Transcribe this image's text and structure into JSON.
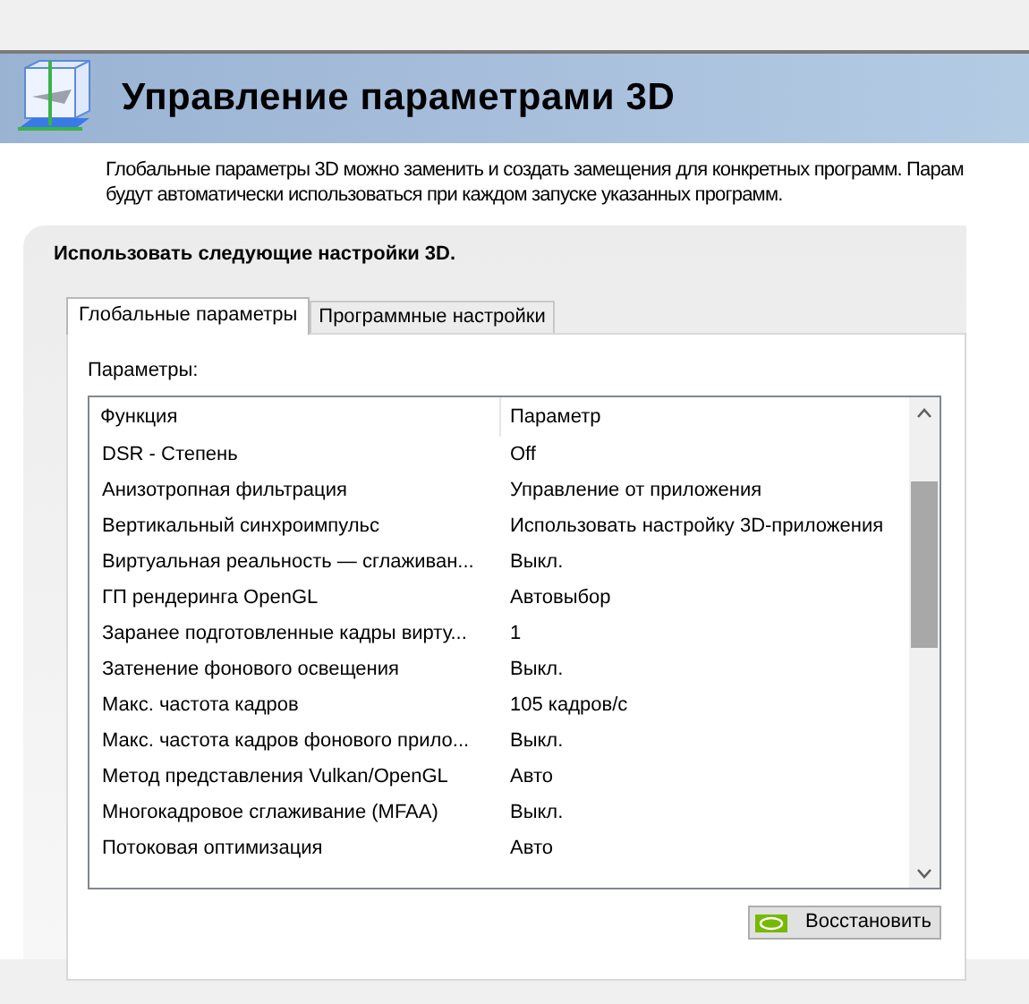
{
  "header": {
    "title": "Управление параметрами 3D"
  },
  "description": [
    "Глобальные параметры 3D можно заменить и создать замещения для конкретных программ. Парам",
    "будут автоматически использоваться при каждом запуске указанных программ."
  ],
  "panel": {
    "heading": "Использовать следующие настройки 3D."
  },
  "tabs": [
    {
      "label": "Глобальные параметры",
      "selected": true
    },
    {
      "label": "Программные настройки",
      "selected": false
    }
  ],
  "settings": {
    "label": "Параметры:",
    "columns": [
      "Функция",
      "Параметр"
    ],
    "rows": [
      {
        "function": "DSR - Степень",
        "value": "Off"
      },
      {
        "function": "Анизотропная фильтрация",
        "value": "Управление от приложения"
      },
      {
        "function": "Вертикальный синхроимпульс",
        "value": "Использовать настройку 3D-приложения"
      },
      {
        "function": "Виртуальная реальность — сглаживан...",
        "value": "Выкл."
      },
      {
        "function": "ГП рендеринга OpenGL",
        "value": "Автовыбор"
      },
      {
        "function": "Заранее подготовленные кадры вирту...",
        "value": "1"
      },
      {
        "function": "Затенение фонового освещения",
        "value": "Выкл."
      },
      {
        "function": "Макс. частота кадров",
        "value": "105 кадров/с"
      },
      {
        "function": "Макс. частота кадров фонового прило...",
        "value": "Выкл."
      },
      {
        "function": "Метод представления Vulkan/OpenGL",
        "value": "Авто"
      },
      {
        "function": "Многокадровое сглаживание (MFAA)",
        "value": "Выкл."
      },
      {
        "function": "Потоковая оптимизация",
        "value": "Авто"
      }
    ]
  },
  "restore_button": {
    "label": "Восстановить"
  }
}
